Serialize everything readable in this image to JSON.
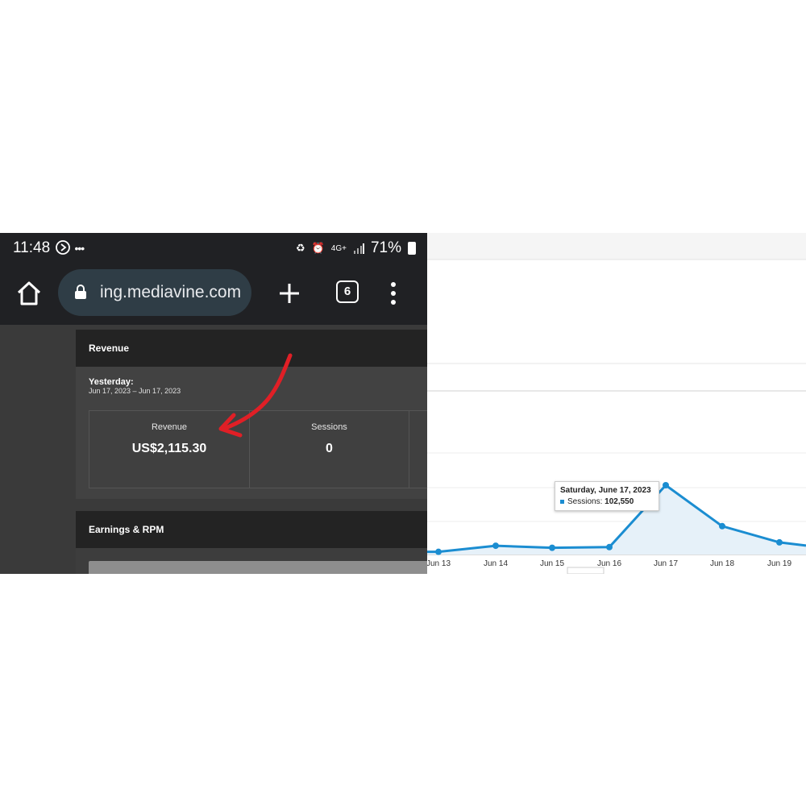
{
  "status_bar": {
    "time": "11:48",
    "network": "4G+",
    "battery": "71%",
    "icons": [
      "play-circle-icon",
      "more-dots-icon",
      "battery-saver-icon",
      "alarm-icon",
      "signal-icon",
      "battery-icon"
    ]
  },
  "browser": {
    "url": "ing.mediavine.com",
    "tab_count": "6",
    "icons": [
      "home-icon",
      "lock-icon",
      "plus-icon",
      "tabs-icon",
      "menu-icon"
    ]
  },
  "revenue_card": {
    "title": "Revenue",
    "period_label": "Yesterday:",
    "period_range": "Jun 17, 2023 – Jun 17, 2023",
    "metrics": [
      {
        "label": "Revenue",
        "value": "US$2,115.30"
      },
      {
        "label": "Sessions",
        "value": "0"
      }
    ]
  },
  "earnings_card": {
    "title": "Earnings & RPM"
  },
  "annotation": {
    "arrow_color": "#e01f26"
  },
  "chart_data": {
    "type": "area",
    "categories": [
      "Jun 13",
      "Jun 14",
      "Jun 15",
      "Jun 16",
      "Jun 17",
      "Jun 18",
      "Jun 19"
    ],
    "series": [
      {
        "name": "Sessions",
        "values": [
          4000,
          13000,
          10000,
          11000,
          102550,
          42000,
          18000
        ],
        "color": "#1b8dd1"
      }
    ],
    "tooltip": {
      "date": "Saturday, June 17, 2023",
      "series_label": "Sessions:",
      "value": "102,550"
    },
    "grid": true
  }
}
